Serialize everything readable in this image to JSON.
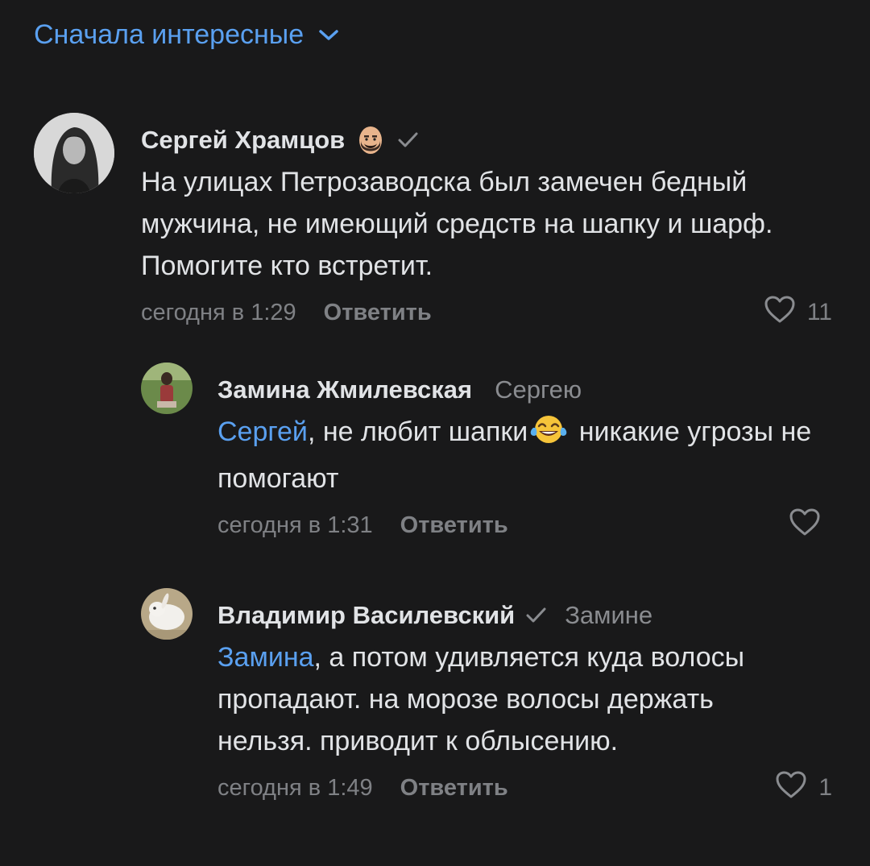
{
  "sort": {
    "label": "Сначала интересные",
    "icon": "chevron-down-icon"
  },
  "colors": {
    "background": "#19191a",
    "accent": "#5aa0f0",
    "text": "#e1e3e6",
    "secondary": "#7f8185"
  },
  "comments": [
    {
      "author": "Сергей Храмцов",
      "author_badge": "bald-man-emoji-icon",
      "verified": true,
      "text": "На улицах Петрозаводска был замечен бедный мужчина, не имеющий средств на шапку и шарф. Помогите кто встретит.",
      "time": "сегодня в 1:29",
      "reply_label": "Ответить",
      "likes": "11"
    },
    {
      "author": "Замина Жмилевская",
      "reply_to": "Сергею",
      "mention": "Сергей",
      "text_before_emoji": ", не любит шапки",
      "emoji": "face-with-tears-of-joy-icon",
      "text_after_emoji": " никакие угрозы не помогают",
      "time": "сегодня в 1:31",
      "reply_label": "Ответить",
      "likes": ""
    },
    {
      "author": "Владимир Василевский",
      "verified": true,
      "reply_to": "Замине",
      "mention": "Замина",
      "text": ", а потом удивляется куда волосы пропадают. на морозе волосы держать нельзя. приводит к облысению.",
      "time": "сегодня в 1:49",
      "reply_label": "Ответить",
      "likes": "1"
    }
  ]
}
